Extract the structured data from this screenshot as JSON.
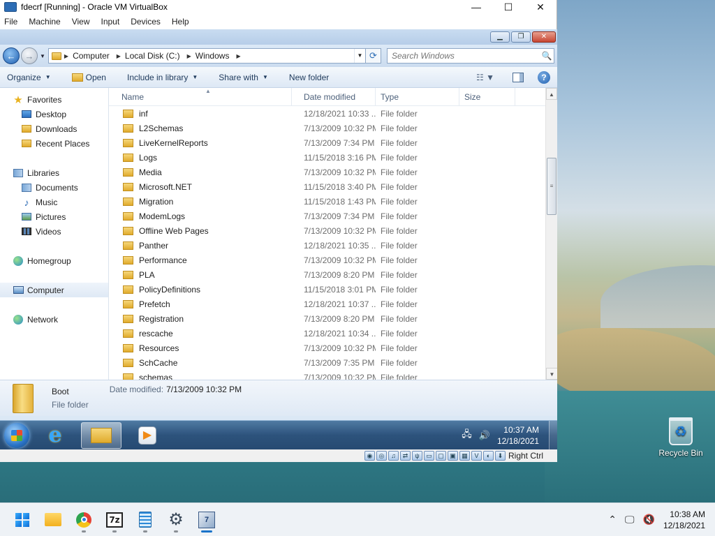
{
  "vbox": {
    "title": "fdecrf [Running] - Oracle VM VirtualBox",
    "menu": [
      "File",
      "Machine",
      "View",
      "Input",
      "Devices",
      "Help"
    ],
    "status_text": "Right Ctrl"
  },
  "explorer": {
    "address": [
      "Computer",
      "Local Disk (C:)",
      "Windows"
    ],
    "search_placeholder": "Search Windows",
    "commands": {
      "organize": "Organize",
      "open": "Open",
      "include": "Include in library",
      "share": "Share with",
      "new_folder": "New folder"
    },
    "nav": {
      "favorites": "Favorites",
      "desktop": "Desktop",
      "downloads": "Downloads",
      "recent": "Recent Places",
      "libraries": "Libraries",
      "documents": "Documents",
      "music": "Music",
      "pictures": "Pictures",
      "videos": "Videos",
      "homegroup": "Homegroup",
      "computer": "Computer",
      "network": "Network"
    },
    "columns": {
      "name": "Name",
      "date": "Date modified",
      "type": "Type",
      "size": "Size"
    },
    "rows": [
      {
        "name": "inf",
        "date": "12/18/2021 10:33 ...",
        "type": "File folder"
      },
      {
        "name": "L2Schemas",
        "date": "7/13/2009 10:32 PM",
        "type": "File folder"
      },
      {
        "name": "LiveKernelReports",
        "date": "7/13/2009 7:34 PM",
        "type": "File folder"
      },
      {
        "name": "Logs",
        "date": "11/15/2018 3:16 PM",
        "type": "File folder"
      },
      {
        "name": "Media",
        "date": "7/13/2009 10:32 PM",
        "type": "File folder"
      },
      {
        "name": "Microsoft.NET",
        "date": "11/15/2018 3:40 PM",
        "type": "File folder"
      },
      {
        "name": "Migration",
        "date": "11/15/2018 1:43 PM",
        "type": "File folder"
      },
      {
        "name": "ModemLogs",
        "date": "7/13/2009 7:34 PM",
        "type": "File folder"
      },
      {
        "name": "Offline Web Pages",
        "date": "7/13/2009 10:32 PM",
        "type": "File folder"
      },
      {
        "name": "Panther",
        "date": "12/18/2021 10:35 ...",
        "type": "File folder"
      },
      {
        "name": "Performance",
        "date": "7/13/2009 10:32 PM",
        "type": "File folder"
      },
      {
        "name": "PLA",
        "date": "7/13/2009 8:20 PM",
        "type": "File folder"
      },
      {
        "name": "PolicyDefinitions",
        "date": "11/15/2018 3:01 PM",
        "type": "File folder"
      },
      {
        "name": "Prefetch",
        "date": "12/18/2021 10:37 ...",
        "type": "File folder"
      },
      {
        "name": "Registration",
        "date": "7/13/2009 8:20 PM",
        "type": "File folder"
      },
      {
        "name": "rescache",
        "date": "12/18/2021 10:34 ...",
        "type": "File folder"
      },
      {
        "name": "Resources",
        "date": "7/13/2009 10:32 PM",
        "type": "File folder"
      },
      {
        "name": "SchCache",
        "date": "7/13/2009 7:35 PM",
        "type": "File folder"
      },
      {
        "name": "schemas",
        "date": "7/13/2009 10:32 PM",
        "type": "File folder"
      }
    ],
    "details": {
      "name": "Boot",
      "type": "File folder",
      "modified_label": "Date modified:",
      "modified_value": "7/13/2009 10:32 PM"
    }
  },
  "guest_taskbar": {
    "time": "10:37 AM",
    "date": "12/18/2021"
  },
  "host": {
    "recycle_label": "Recycle Bin",
    "time": "10:38 AM",
    "date": "12/18/2021"
  }
}
